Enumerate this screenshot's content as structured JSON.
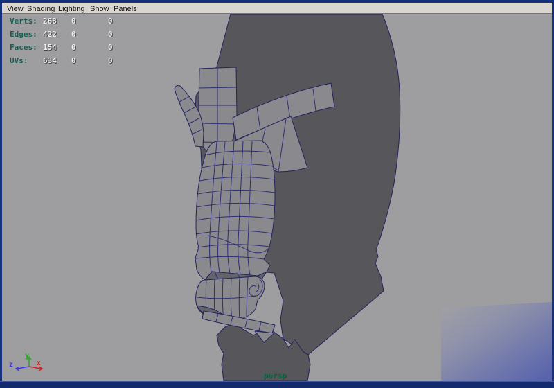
{
  "menu_bar": {
    "items": [
      {
        "label": "View"
      },
      {
        "label": "Shading"
      },
      {
        "label": "Lighting"
      },
      {
        "label": "Show"
      },
      {
        "label": "Panels"
      }
    ]
  },
  "hud": {
    "rows": [
      {
        "label": "Verts:",
        "v1": "268",
        "v2": "0",
        "v3": "0"
      },
      {
        "label": "Edges:",
        "v1": "422",
        "v2": "0",
        "v3": "0"
      },
      {
        "label": "Faces:",
        "v1": "154",
        "v2": "0",
        "v3": "0"
      },
      {
        "label": "UVs:",
        "v1": "634",
        "v2": "0",
        "v3": "0"
      }
    ]
  },
  "viewport": {
    "camera_label": "persp"
  },
  "axis": {
    "x_label": "x",
    "y_label": "y",
    "z_label": "z"
  },
  "colors": {
    "frame": "#15317b",
    "bottom_bar": "#132a6f",
    "menu_bg": "#d9d6cf",
    "viewport_bg": "#9e9ea1",
    "head_fill": "#57575b",
    "head_outline": "#23235c",
    "mesh_fill": "#8a8a8e",
    "mesh_shade": "#63636a",
    "wire": "#2e2e74",
    "hud_label": "#175f54",
    "hud_value": "#eeeeec",
    "persp_green": "#0d7a4a",
    "axis_x": "#cc2222",
    "axis_y": "#22aa22",
    "axis_z": "#3a3aee",
    "plane_top": "#a2a2a4",
    "plane_mid": "#8d90ab",
    "plane_bottom": "#5864ac"
  }
}
